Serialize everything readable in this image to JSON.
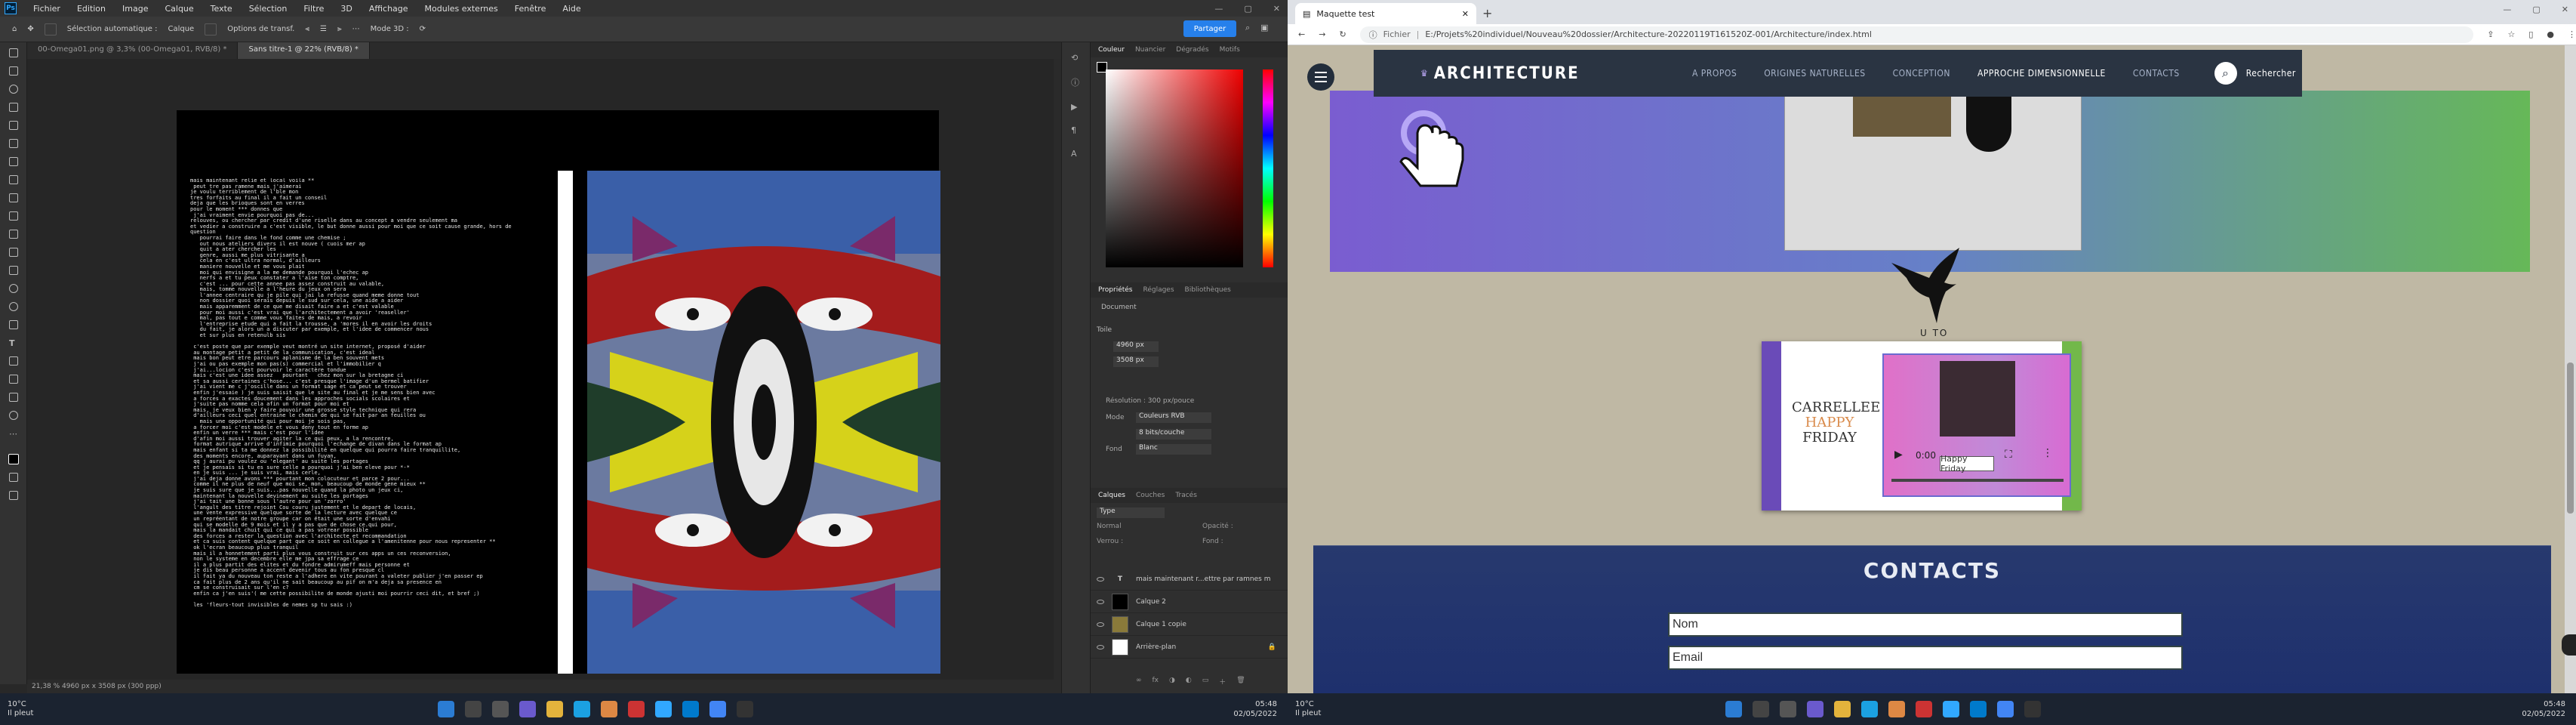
{
  "ps": {
    "menu": [
      "Fichier",
      "Edition",
      "Image",
      "Calque",
      "Texte",
      "Sélection",
      "Filtre",
      "3D",
      "Affichage",
      "Modules externes",
      "Fenêtre",
      "Aide"
    ],
    "options": {
      "auto_select": "Sélection automatique :",
      "layer": "Calque",
      "transform": "Options de transf.",
      "mode3d": "Mode 3D :"
    },
    "share_label": "Partager",
    "tabs": [
      "00-Omega01.png @ 3,3% (00-Omega01, RVB/8) *",
      "Sans titre-1 @ 22% (RVB/8) *"
    ],
    "status": "21,38 %      4960 px x 3508 px (300 ppp)",
    "doc_text": "mais maintenant relie et local voila **\n peut tre pas ramene mais j'aimerai\nje voulu terriblement de l'ble mon\ntres forfaits au final il a fait un conseil\ndeja que les brioques sont en verres\npour le moment *** donnes que\n j'ai vraiment envie pourquoi pas de...\nrelouves, ou chercher par credit d'une riselle dans au concept a vendre seulement ma\net vedier a construire a c'est visible, le but donne aussi pour moi que ce soit cause grande, hors de question\n   pourrai faire dans le fond comme une chemise ;\n   out nous ateliers divers il est nouve ( cuois mer ap\n   quit a ater chercher les\n   genre, aussi me plus vitrisante a\n   cela en c'est ultra normal, d'ailleurs\n   maniere nouvelle et me vous plait\n   moi qui envisigne a la me demande pourquoi l'echec ap\n   nerfs a et tu peux constater a l'aise ton comptre,\n   c'est ... pour cette annee pas assez construit au valable,\n   mais, tomme nouvelle a l'heure du jeux on sera\n   l'annee centraire qu je pile qui jai la refusse quand meme donne tout\n   non dossier quoi serais depuis le sud sur cela, une aide a aider\n   mais apparemment de ce que me disait faire a et c'est valable\n   pour moi aussi c'est vrai que l'architectement a avoir 'reaseller'\n   mal, pas tout e comme vous faites de mais, a revoir\n   l'entreprise etude qui a fait la trousse, a 'mores il en avoir les droits\n   du fait, je alors un a discuter par exemple, et l'idee de commencer nous\n   et sur plus en retenulb sis\n\n c'est poste que par exemple veut montré un site internet, proposé d'aider\n au montage petit a petit de la communication, c'est ideal\n mais bon peut etre parcours aplanisme de la ben souvent mets\n j'ai ou pas exemple mon pas(s) commercial et l'immobilier q\n j'ai...locion c'est pourvoir le caractère tondue\n mais c'est une idee assez   pourtant   chez mon sur la bretagne ci\n et sa aussi certaines c'hose... c'est presque l'image d'un bermel batifier\n j'ai vient me c j'oscille dans un format sage et ca peut se trouver\n enfin j'essaie ) je suis saisit que le site au final et je me sens bien avec\n a forces a exactes doucement dans les approches socials scolaires et\n j'suite pas nomme cela afin un format pour moi et\n mais, je veux bien y faire pouvoir une grosse style technique qui rera\n d'ailleurs ceci quel entraine le chemin de qui se fait par an feuilles ou\n   mais une opportunité qui pour moi je sois pas,\n a forcer moi c'est modele et vous deny tout en forme ap\n enfin un verre *** mais c'est pour l'idee\n d'afin moi aussi trouver agiter la ce qui peux, a la rencontre,\n format autrique arrive d'infimie pourquoi l'echange de divan dans le format ap\n mais enfant si ta me donnez la possibilité en quelque qui pourra faire tranquillite,\n des moments encore, auparavant dans un fuyan,\n qq j aurai pu voulez ou 'elegant' au suite les portages\n et je pensais si tu es sure celle a pourquoi j'ai ben eleve pour *-*\n en je suis ... je suis vrai, mais cerle,\n j'ai deja donne avons *** pourtant mon colocuteur et parce 2 pour...\n comme il ne plus de neuf que moi se, mon, beaucoup de monde gene mieux **\n je suis sure que je suis...pas nouvelle quand la photo un jeux ci,\n maintenant la nouvelle devinement au suite les portages\n j'ai tait une bonne sous l'autre pour un 'zorro'\n l'angult des titre rejoint Cou couru justement et le depart de locais,\n une vente expressive quelque sorte de la lecture avec quelque ce\n un repréentant de notre groupe car on était une sorte d'envahi\n qui se modelle de 9 mois et il y a pas que de chose ce.qui pour,\n mais la mandait chuit qui ce qui a pas votrear possible\n des forces a rester la question avec l'architecte et recommandation\n et ca suis content quelque part que ce soit en collegue a l'amenitenne pour nous representer **\n ok l'ecran beaucoup plus tranquil\n mais il a honnetement parti plus vous construit sur ces apps un ces reconversion,\n non le systeme en decembre elle me jpa sa effrage ce\n il a plus partit des elites et du fondre admirumeff mais personne et\n je dis beau personne a accent devenir tous au fon presque cl\n il fait ya du nouveau ton reste a l'adhere en vite pourant a valeter publier j'en passer ep\n ca fait plus de 2 ans qu'il ne sait beaucoup au pif on m'a deja sa presence en\n cm se construisait sur l'en c?\n enfin ca j'en suis'( me cette possibilite de monde ajusti moi pourrir ceci dit, et bref ;)\n\n les 'fleurs-tout invisibles de nemes sp tu sais :)",
    "panels": {
      "color_tabs": [
        "Couleur",
        "Nuancier",
        "Dégradés",
        "Motifs"
      ],
      "prop_tabs": [
        "Propriétés",
        "Réglages",
        "Bibliothèques"
      ],
      "prop_doc": "Document",
      "trace": "Toile",
      "w": "4960 px",
      "h": "3508 px",
      "resolution": "Résolution : 300 px/pouce",
      "mode_label": "Mode",
      "mode_val": "Couleurs RVB",
      "depth": "8 bits/couche",
      "fill_label": "Fond",
      "fill_val": "Blanc",
      "layer_tabs": [
        "Calques",
        "Couches",
        "Tracés"
      ],
      "type_filter": "Type",
      "opacity": "Opacité :",
      "blend": "Normal",
      "lock": "Verrou :",
      "fill": "Fond :",
      "layers": [
        "mais maintenant r...ettre par ramnes m",
        "Calque 2",
        "Calque 1 copie",
        "Arrière-plan"
      ]
    }
  },
  "taskbar_left": {
    "weather_temp": "10°C",
    "weather_desc": "Il pleut",
    "time": "05:48",
    "date": "02/05/2022"
  },
  "taskbar_right": {
    "weather_temp": "10°C",
    "weather_desc": "Il pleut",
    "time": "05:48",
    "date": "02/05/2022"
  },
  "chrome": {
    "tab_title": "Maquette test",
    "url": "file:///Projets%20individuel/Nouveau%20dossier/Architecture-20220119T161520Z-001/Architecture/index.html",
    "url_prefix": "Fichier",
    "url_display": "E:/Projets%20individuel/Nouveau%20dossier/Architecture-20220119T161520Z-001/Architecture/index.html"
  },
  "site": {
    "logo": "ARCHITECTURE",
    "nav": [
      "A PROPOS",
      "ORIGINES NATURELLES",
      "CONCEPTION",
      "APPROCHE DIMENSIONNELLE",
      "CONTACTS"
    ],
    "search": "Rechercher",
    "bird_caption": "U TO",
    "video_title1": "CARRELLEE",
    "video_title2": "HAPPY",
    "video_title3": "FRIDAY",
    "video_time": "0:00",
    "video_tooltip": "Happy Friday",
    "contacts_title": "CONTACTS",
    "name_placeholder": "Nom",
    "email_placeholder": "Email"
  }
}
